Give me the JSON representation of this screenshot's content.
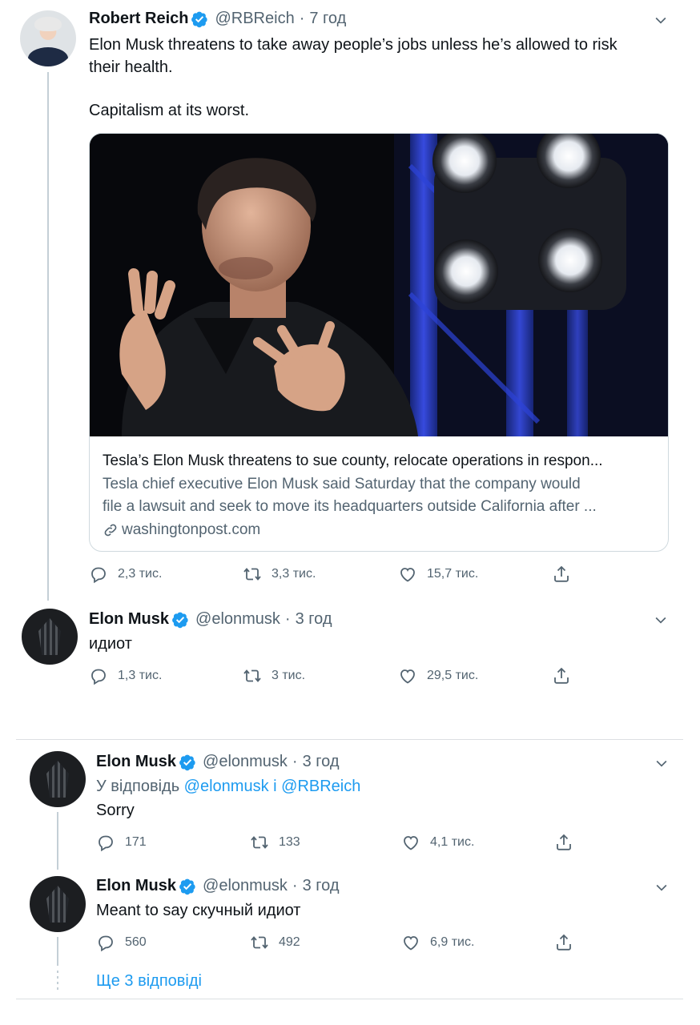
{
  "colors": {
    "accent": "#1d9bf0",
    "text": "#0f1419",
    "muted": "#536471",
    "line": "#c4cfd6"
  },
  "tweets": [
    {
      "name": "Robert Reich",
      "handle": "@RBReich",
      "sep": "·",
      "time": "7 год",
      "text_line1": "Elon Musk threatens to take away people’s jobs unless he’s allowed to risk",
      "text_line2": "their health.",
      "text_line3": "Capitalism at its worst.",
      "card": {
        "title": "Tesla’s Elon Musk threatens to sue county, relocate operations in respon...",
        "desc_line1": "Tesla chief executive Elon Musk said Saturday that the company would",
        "desc_line2": "file a lawsuit and seek to move its headquarters outside California after ...",
        "domain": "washingtonpost.com"
      },
      "replies": "2,3 тис.",
      "retweets": "3,3 тис.",
      "likes": "15,7 тис."
    },
    {
      "name": "Elon Musk",
      "handle": "@elonmusk",
      "sep": "·",
      "time": "3 год",
      "text": "идиот",
      "replies": "1,3 тис.",
      "retweets": "3 тис.",
      "likes": "29,5 тис."
    },
    {
      "name": "Elon Musk",
      "handle": "@elonmusk",
      "sep": "·",
      "time": "3 год",
      "reply_prefix": "У відповідь ",
      "reply_to_1": "@elonmusk",
      "reply_joiner": " і ",
      "reply_to_2": "@RBReich",
      "text": "Sorry",
      "replies": "171",
      "retweets": "133",
      "likes": "4,1 тис."
    },
    {
      "name": "Elon Musk",
      "handle": "@elonmusk",
      "sep": "·",
      "time": "3 год",
      "text": "Meant to say скучный идиот",
      "replies": "560",
      "retweets": "492",
      "likes": "6,9 тис."
    }
  ],
  "show_more": "Ще 3 відповіді",
  "icons": [
    "verified-badge-icon",
    "chevron-down-icon",
    "reply-icon",
    "retweet-icon",
    "like-icon",
    "share-icon",
    "link-icon"
  ]
}
